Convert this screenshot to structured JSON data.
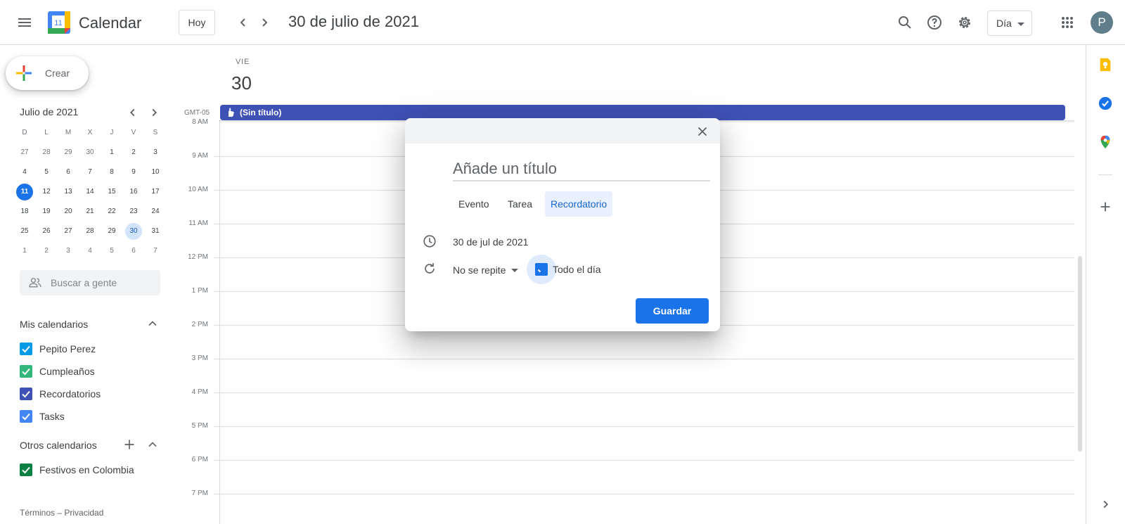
{
  "header": {
    "app_title": "Calendar",
    "logo_number": "11",
    "today_label": "Hoy",
    "current_date": "30 de julio de 2021",
    "view_label": "Día",
    "avatar_initial": "P"
  },
  "sidebar": {
    "create_label": "Crear",
    "mini_calendar": {
      "title": "Julio de 2021",
      "weekdays": [
        "D",
        "L",
        "M",
        "X",
        "J",
        "V",
        "S"
      ],
      "weeks": [
        [
          "27",
          "28",
          "29",
          "30",
          "1",
          "2",
          "3"
        ],
        [
          "4",
          "5",
          "6",
          "7",
          "8",
          "9",
          "10"
        ],
        [
          "11",
          "12",
          "13",
          "14",
          "15",
          "16",
          "17"
        ],
        [
          "18",
          "19",
          "20",
          "21",
          "22",
          "23",
          "24"
        ],
        [
          "25",
          "26",
          "27",
          "28",
          "29",
          "30",
          "31"
        ],
        [
          "1",
          "2",
          "3",
          "4",
          "5",
          "6",
          "7"
        ]
      ],
      "today": "11",
      "selected": "30"
    },
    "people_search_placeholder": "Buscar a gente",
    "my_calendars": {
      "title": "Mis calendarios",
      "items": [
        {
          "name": "Pepito Perez",
          "color": "#039be5"
        },
        {
          "name": "Cumpleaños",
          "color": "#33b679"
        },
        {
          "name": "Recordatorios",
          "color": "#3f51b5"
        },
        {
          "name": "Tasks",
          "color": "#4285f4"
        }
      ]
    },
    "other_calendars": {
      "title": "Otros calendarios",
      "items": [
        {
          "name": "Festivos en Colombia",
          "color": "#0b8043"
        }
      ]
    },
    "footer": "Términos – Privacidad"
  },
  "main": {
    "day_of_week": "VIE",
    "day_number": "30",
    "timezone": "GMT-05",
    "all_day_event": {
      "title": "(Sin título)",
      "color": "#3f51b5"
    },
    "hours": [
      "8 AM",
      "9 AM",
      "10 AM",
      "11 AM",
      "12 PM",
      "1 PM",
      "2 PM",
      "3 PM",
      "4 PM",
      "5 PM",
      "6 PM",
      "7 PM"
    ]
  },
  "dialog": {
    "title_placeholder": "Añade un título",
    "tabs": [
      "Evento",
      "Tarea",
      "Recordatorio"
    ],
    "active_tab": "Recordatorio",
    "date": "30 de jul de 2021",
    "repeat": "No se repite",
    "all_day_label": "Todo el día",
    "save_label": "Guardar"
  },
  "colors": {
    "accent": "#1a73e8",
    "event": "#3f51b5"
  }
}
